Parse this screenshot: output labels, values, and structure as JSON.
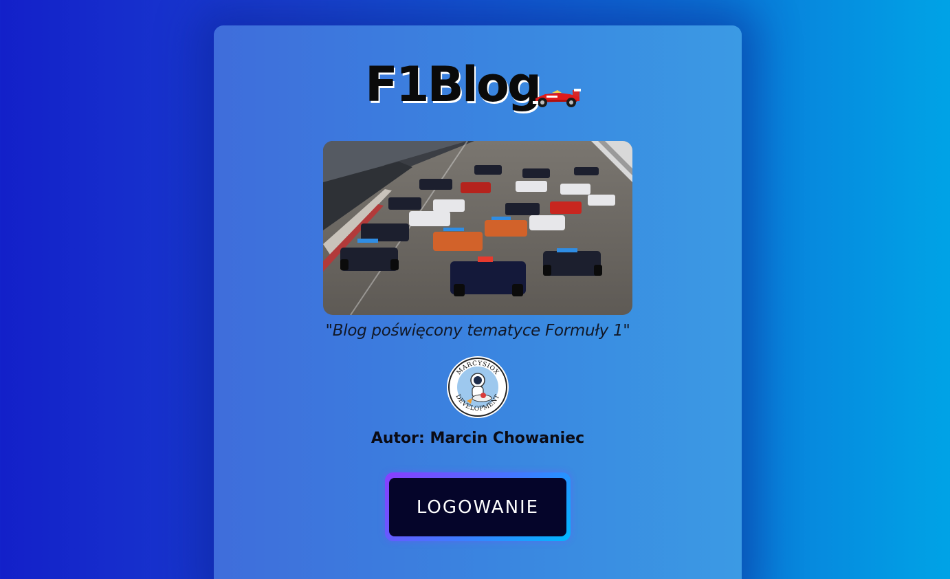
{
  "header": {
    "title": "F1Blog",
    "title_icon": "race-car-icon"
  },
  "hero": {
    "image": "f1-race-start-photo"
  },
  "tagline": "\"Blog poświęcony tematyce Formuły 1\"",
  "logo": {
    "top_text": "MARCYSIOX",
    "bottom_text": "DEVELOPMENT"
  },
  "author": "Autor: Marcin Chowaniec",
  "login_button": {
    "label": "LOGOWANIE"
  },
  "colors": {
    "background_start": "#1320c9",
    "background_end": "#00a3e6",
    "card": "#3a86e0",
    "button_bg": "#05052a",
    "button_border_start": "#8a3dff",
    "button_border_end": "#00b8ff"
  }
}
